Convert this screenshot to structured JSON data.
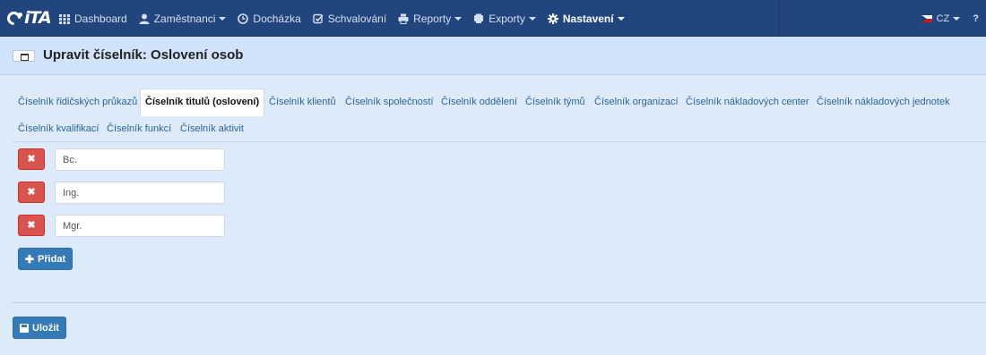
{
  "brand": {
    "logo_text": "iTA"
  },
  "nav": {
    "items": [
      {
        "label": "Dashboard",
        "icon": "grid-icon",
        "caret": false,
        "active": false
      },
      {
        "label": "Zaměstnanci",
        "icon": "user-icon",
        "caret": true,
        "active": false
      },
      {
        "label": "Docházka",
        "icon": "clock-icon",
        "caret": false,
        "active": false
      },
      {
        "label": "Schvalování",
        "icon": "check-square-icon",
        "caret": false,
        "active": false
      },
      {
        "label": "Reporty",
        "icon": "printer-icon",
        "caret": true,
        "active": false
      },
      {
        "label": "Exporty",
        "icon": "export-icon",
        "caret": true,
        "active": false
      },
      {
        "label": "Nastavení",
        "icon": "gear-icon",
        "caret": true,
        "active": true
      }
    ],
    "language": "CZ",
    "help": "?"
  },
  "page": {
    "title": "Upravit číselník: Oslovení osob"
  },
  "tabs": [
    {
      "label": "Číselník řidičských průkazů",
      "active": false
    },
    {
      "label": "Číselník titulů (oslovení)",
      "active": true
    },
    {
      "label": "Číselník klientů",
      "active": false
    },
    {
      "label": "Číselník společností",
      "active": false
    },
    {
      "label": "Číselník oddělení",
      "active": false
    },
    {
      "label": "Číselník týmů",
      "active": false
    },
    {
      "label": "Číselník organizací",
      "active": false
    },
    {
      "label": "Číselník nákladových center",
      "active": false
    },
    {
      "label": "Číselník nákladových jednotek",
      "active": false
    },
    {
      "label": "Číselník kvalifikací",
      "active": false
    },
    {
      "label": "Číselník funkcí",
      "active": false
    },
    {
      "label": "Číselník aktivit",
      "active": false
    }
  ],
  "rows": [
    {
      "value": "Bc."
    },
    {
      "value": "Ing."
    },
    {
      "value": "Mgr."
    }
  ],
  "buttons": {
    "add_label": "Přidat",
    "save_label": "Uložit",
    "delete_symbol": "✖"
  },
  "colors": {
    "navbar": "#21457d",
    "danger": "#d9534f",
    "primary": "#337ab7",
    "link": "#2a6496"
  }
}
